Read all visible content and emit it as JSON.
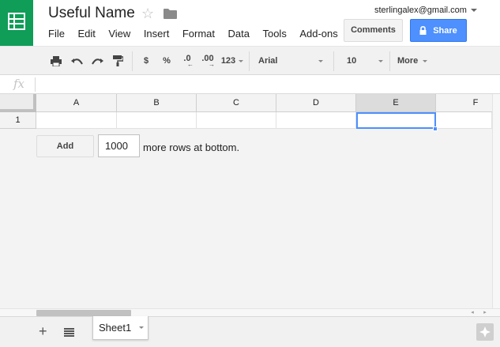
{
  "header": {
    "doc_title": "Useful Name",
    "star_icon": "star-outline-icon",
    "folder_icon": "folder-icon",
    "account_email": "sterlingalex@gmail.com",
    "comments_label": "Comments",
    "share_label": "Share",
    "brand_color": "#0f9d58",
    "share_color": "#4d90fe"
  },
  "menu": [
    "File",
    "Edit",
    "View",
    "Insert",
    "Format",
    "Data",
    "Tools",
    "Add-ons"
  ],
  "toolbar": {
    "currency": "$",
    "percent": "%",
    "decrease_decimals": ".0",
    "increase_decimals": ".00",
    "number_format": "123",
    "font_family": "Arial",
    "font_size": "10",
    "more": "More"
  },
  "formula_bar": {
    "icon": "fx",
    "value": ""
  },
  "grid": {
    "columns": [
      "A",
      "B",
      "C",
      "D",
      "E",
      "F"
    ],
    "selected_column": "E",
    "rows": [
      "1"
    ],
    "active_cell": "E1"
  },
  "add_rows": {
    "button_label": "Add",
    "count": "1000",
    "suffix": "more rows at bottom."
  },
  "sheets": {
    "tabs": [
      {
        "label": "Sheet1",
        "active": true
      }
    ]
  }
}
